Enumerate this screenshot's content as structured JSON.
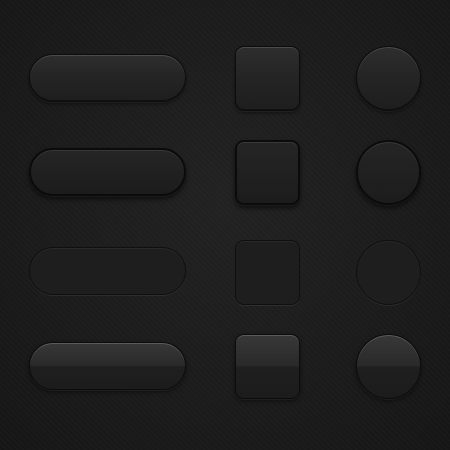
{
  "background_color": "#1c1c1c",
  "button_color": "#262626",
  "outline_color": "#0c0c0c",
  "rows": [
    {
      "style": "raised-glossy",
      "shapes": [
        "pill",
        "square",
        "circle"
      ]
    },
    {
      "style": "raised-dark-bevel",
      "shapes": [
        "pill",
        "square",
        "circle"
      ]
    },
    {
      "style": "flat-outline",
      "shapes": [
        "pill",
        "square",
        "circle"
      ]
    },
    {
      "style": "glossy-convex",
      "shapes": [
        "pill",
        "square",
        "circle"
      ]
    }
  ]
}
